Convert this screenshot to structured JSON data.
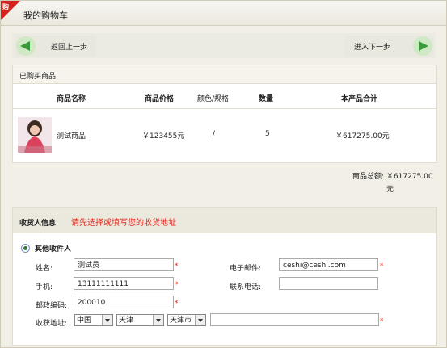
{
  "window": {
    "title": "我的购物车",
    "badge": "购"
  },
  "nav": {
    "prev_label": "返回上一步",
    "next_label": "进入下一步"
  },
  "cart": {
    "section_title": "已购买商品",
    "columns": [
      "商品名称",
      "商品价格",
      "颜色/规格",
      "数量",
      "本产品合计"
    ],
    "rows": [
      {
        "name": "测试商品",
        "price": "￥123455元",
        "spec": "/",
        "qty": "5",
        "subtotal": "￥617275.00元"
      }
    ],
    "total_label": "商品总额:",
    "total_value": "￥617275.00",
    "total_unit": "元"
  },
  "consignee": {
    "section_title": "收货人信息",
    "hint": "请先选择或填写您的收货地址",
    "option_label": "其他收件人",
    "fields": {
      "name_label": "姓名:",
      "name_value": "测试员",
      "email_label": "电子邮件:",
      "email_value": "ceshi@ceshi.com",
      "phone_label": "手机:",
      "phone_value": "13111111111",
      "tel_label": "联系电话:",
      "tel_value": "",
      "zip_label": "邮政编码:",
      "zip_value": "200010",
      "addr_label": "收获地址:",
      "country": "中国",
      "province": "天津",
      "city": "天津市",
      "street_value": ""
    },
    "required_mark": "*"
  },
  "colors": {
    "accent_red": "#e0261c",
    "arrow_green": "#3a9a3a"
  }
}
